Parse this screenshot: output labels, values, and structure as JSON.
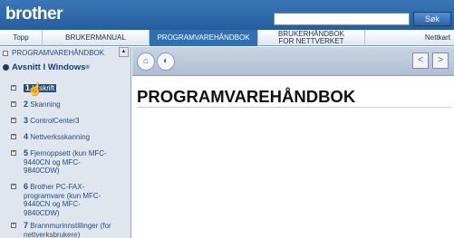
{
  "header": {
    "logo": "brother",
    "search_button": "Søk",
    "search_value": ""
  },
  "nav": {
    "items": [
      {
        "label": "Topp"
      },
      {
        "label": "BRUKERMANUAL"
      },
      {
        "label": "PROGRAMVAREHÅNDBOK",
        "active": true
      },
      {
        "label": "BRUKERHÅNDBOK\nFOR NETTVERKET"
      },
      {
        "label": "Nettkart"
      }
    ]
  },
  "sidebar": {
    "root": "PROGRAMVAREHÅNDBOK",
    "section": "Avsnitt I Windows",
    "section_mark": "®",
    "items": [
      {
        "num": "1",
        "label": "Utskrift",
        "selected": true
      },
      {
        "num": "2",
        "label": "Skanning"
      },
      {
        "num": "3",
        "label": "ControlCenter3"
      },
      {
        "num": "4",
        "label": "Nettverksskanning"
      },
      {
        "num": "5",
        "label": "Fjernoppsett (kun MFC-9440CN og MFC-9840CDW)"
      },
      {
        "num": "6",
        "label": "Brother PC-FAX-programvare (kun MFC-9440CN og MFC-9840CDW)"
      },
      {
        "num": "7",
        "label": "Brannmurinnstillinger (for nettverksbrukere)"
      }
    ]
  },
  "content": {
    "title": "PROGRAMVAREHÅNDBOK"
  },
  "colors": {
    "header": "#2f6aac",
    "active_tab": "#2f6fb4",
    "sidebar_bg": "#dfe6ed"
  }
}
